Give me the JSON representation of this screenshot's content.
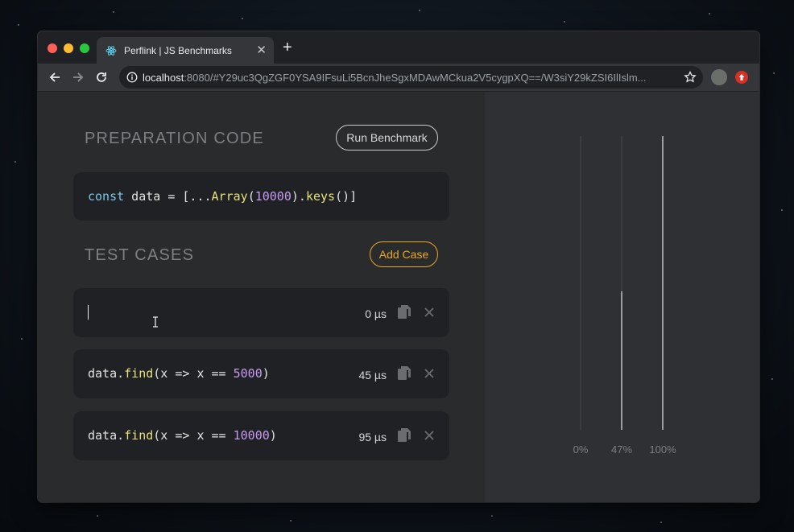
{
  "browser": {
    "tab_title": "Perflink | JS Benchmarks",
    "url_host": "localhost",
    "url_rest": ":8080/#Y29uc3QgZGF0YSA9IFsuLi5BcnJheSgxMDAwMCkua2V5cygpXQ==/W3siY29kZSI6IlIslm...",
    "icons": [
      "react-icon",
      "close-icon",
      "plus-icon",
      "back-icon",
      "forward-icon",
      "reload-icon",
      "info-icon",
      "bookmark-star-icon",
      "extension-avatar-icon",
      "extension-red-icon"
    ]
  },
  "preparation": {
    "title": "PREPARATION CODE",
    "run_button": "Run Benchmark",
    "code": {
      "kw": "const",
      "var": " data = [...",
      "fn": "Array",
      "open": "(",
      "num": "10000",
      "mid": ").",
      "fn2": "keys",
      "end": "()]"
    }
  },
  "tests": {
    "title": "TEST CASES",
    "add_button": "Add Case",
    "cases": [
      {
        "code_a": "",
        "fn": "",
        "code_b": "",
        "num": "",
        "code_c": "",
        "timing": "0 µs",
        "progress_pct": 0
      },
      {
        "code_a": "data.",
        "fn": "find",
        "code_b": "(x => x == ",
        "num": "5000",
        "code_c": ")",
        "timing": "45 µs",
        "progress_pct": 47
      },
      {
        "code_a": "data.",
        "fn": "find",
        "code_b": "(x => x == ",
        "num": "10000",
        "code_c": ")",
        "timing": "95 µs",
        "progress_pct": 100
      }
    ]
  },
  "results": {
    "labels": [
      "0%",
      "47%",
      "100%"
    ]
  },
  "colors": {
    "accent_run": "#c8cbd0",
    "accent_add": "#e9a825",
    "keyword": "#7cc7ea",
    "function": "#e7e07a",
    "number": "#c79bf2"
  }
}
